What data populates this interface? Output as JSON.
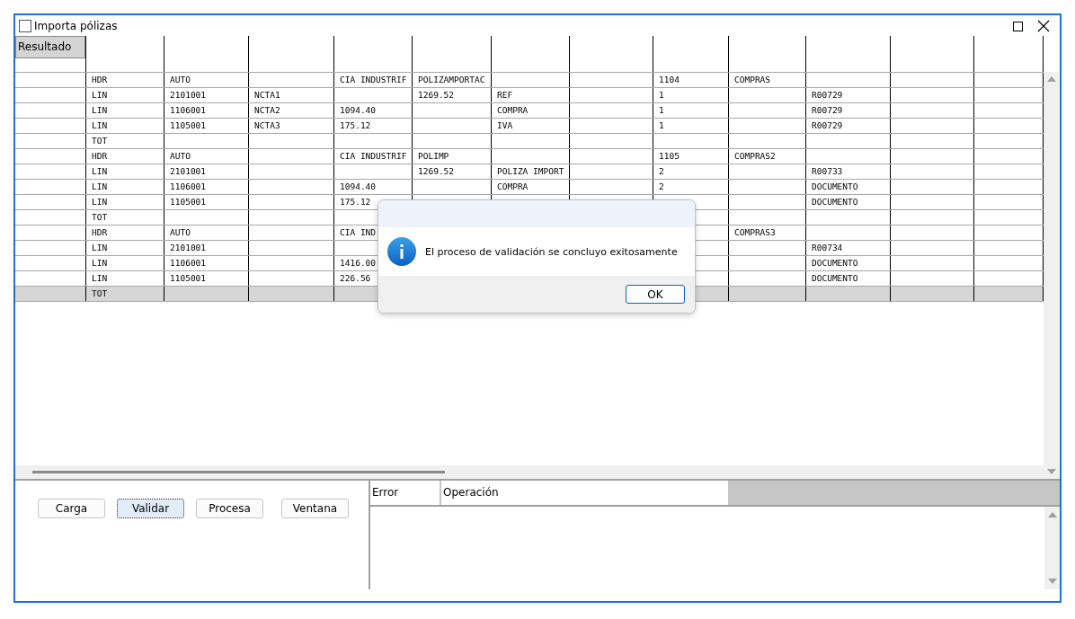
{
  "window": {
    "title": "Importa pólizas"
  },
  "table": {
    "columns": [
      "Resultado",
      null,
      null,
      null,
      null,
      null,
      null,
      null,
      null,
      null,
      null,
      null,
      null
    ],
    "rows": [
      {
        "selected": false,
        "cells": [
          null,
          "HDR",
          "AUTO",
          null,
          "CIA INDUSTRIF",
          "POLIZAMPORTAC",
          null,
          null,
          "1104",
          "COMPRAS",
          null,
          null,
          null
        ]
      },
      {
        "selected": false,
        "cells": [
          null,
          "LIN",
          "2101001",
          "NCTA1",
          null,
          "1269.52",
          "REF",
          null,
          "1",
          null,
          "R00729",
          null,
          null
        ]
      },
      {
        "selected": false,
        "cells": [
          null,
          "LIN",
          "1106001",
          "NCTA2",
          "1094.40",
          null,
          "COMPRA",
          null,
          "1",
          null,
          "R00729",
          null,
          null
        ]
      },
      {
        "selected": false,
        "cells": [
          null,
          "LIN",
          "1105001",
          "NCTA3",
          "175.12",
          null,
          "IVA",
          null,
          "1",
          null,
          "R00729",
          null,
          null
        ]
      },
      {
        "selected": false,
        "cells": [
          null,
          "TOT",
          null,
          null,
          null,
          null,
          null,
          null,
          null,
          null,
          null,
          null,
          null
        ]
      },
      {
        "selected": false,
        "cells": [
          null,
          "HDR",
          "AUTO",
          null,
          "CIA INDUSTRIF",
          "POLIMP",
          null,
          null,
          "1105",
          "COMPRAS2",
          null,
          null,
          null
        ]
      },
      {
        "selected": false,
        "cells": [
          null,
          "LIN",
          "2101001",
          null,
          null,
          "1269.52",
          "POLIZA IMPORT",
          null,
          "2",
          null,
          "R00733",
          null,
          null
        ]
      },
      {
        "selected": false,
        "cells": [
          null,
          "LIN",
          "1106001",
          null,
          "1094.40",
          null,
          "COMPRA",
          null,
          "2",
          null,
          "DOCUMENTO",
          null,
          null
        ]
      },
      {
        "selected": false,
        "cells": [
          null,
          "LIN",
          "1105001",
          null,
          "175.12",
          null,
          null,
          null,
          null,
          null,
          "DOCUMENTO",
          null,
          null
        ]
      },
      {
        "selected": false,
        "cells": [
          null,
          "TOT",
          null,
          null,
          null,
          null,
          null,
          null,
          null,
          null,
          null,
          null,
          null
        ]
      },
      {
        "selected": false,
        "cells": [
          null,
          "HDR",
          "AUTO",
          null,
          "CIA IND",
          null,
          null,
          null,
          null,
          "COMPRAS3",
          null,
          null,
          null
        ]
      },
      {
        "selected": false,
        "cells": [
          null,
          "LIN",
          "2101001",
          null,
          null,
          null,
          null,
          null,
          null,
          null,
          "R00734",
          null,
          null
        ]
      },
      {
        "selected": false,
        "cells": [
          null,
          "LIN",
          "1106001",
          null,
          "1416.00",
          null,
          null,
          null,
          null,
          null,
          "DOCUMENTO",
          null,
          null
        ]
      },
      {
        "selected": false,
        "cells": [
          null,
          "LIN",
          "1105001",
          null,
          "226.56",
          null,
          null,
          null,
          null,
          null,
          "DOCUMENTO",
          null,
          null
        ]
      },
      {
        "selected": true,
        "cells": [
          null,
          "TOT",
          null,
          null,
          null,
          null,
          null,
          null,
          null,
          null,
          null,
          null,
          null
        ]
      }
    ]
  },
  "buttons": [
    {
      "label": "Carga",
      "focused": false
    },
    {
      "label": "Validar",
      "focused": true
    },
    {
      "label": "Procesa",
      "focused": false
    },
    {
      "label": "Ventana",
      "focused": false
    }
  ],
  "errors": {
    "columns": [
      "Error",
      "Operación"
    ]
  },
  "dialog": {
    "message": "El proceso de validación se concluyo exitosamente",
    "button": "OK"
  }
}
